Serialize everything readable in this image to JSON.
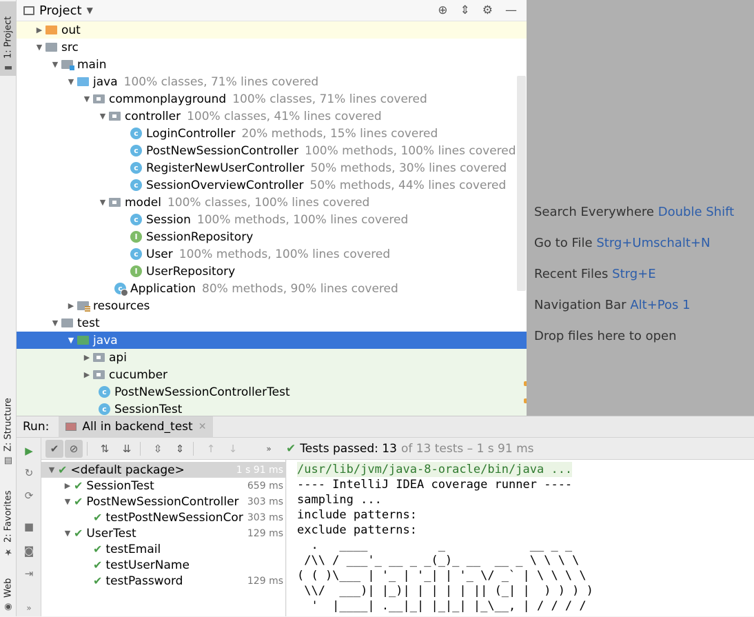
{
  "left_strip": {
    "tabs": [
      {
        "label": "1: Project",
        "icon": "folder-icon"
      },
      {
        "label": "Z: Structure",
        "icon": "structure-icon"
      },
      {
        "label": "2: Favorites",
        "icon": "star-icon"
      },
      {
        "label": "Web",
        "icon": "web-icon"
      }
    ]
  },
  "project": {
    "title": "Project",
    "tree": [
      {
        "label": "out",
        "cov": ""
      },
      {
        "label": "src",
        "cov": ""
      },
      {
        "label": "main",
        "cov": ""
      },
      {
        "label": "java",
        "cov": "100% classes, 71% lines covered"
      },
      {
        "label": "commonplayground",
        "cov": "100% classes, 71% lines covered"
      },
      {
        "label": "controller",
        "cov": "100% classes, 41% lines covered"
      },
      {
        "label": "LoginController",
        "cov": "20% methods, 15% lines covered"
      },
      {
        "label": "PostNewSessionController",
        "cov": "100% methods, 100% lines covered"
      },
      {
        "label": "RegisterNewUserController",
        "cov": "50% methods, 30% lines covered"
      },
      {
        "label": "SessionOverviewController",
        "cov": "50% methods, 44% lines covered"
      },
      {
        "label": "model",
        "cov": "100% classes, 100% lines covered"
      },
      {
        "label": "Session",
        "cov": "100% methods, 100% lines covered"
      },
      {
        "label": "SessionRepository",
        "cov": ""
      },
      {
        "label": "User",
        "cov": "100% methods, 100% lines covered"
      },
      {
        "label": "UserRepository",
        "cov": ""
      },
      {
        "label": "Application",
        "cov": "80% methods, 90% lines covered"
      },
      {
        "label": "resources",
        "cov": ""
      },
      {
        "label": "test",
        "cov": ""
      },
      {
        "label": "java",
        "cov": ""
      },
      {
        "label": "api",
        "cov": ""
      },
      {
        "label": "cucumber",
        "cov": ""
      },
      {
        "label": "PostNewSessionControllerTest",
        "cov": ""
      },
      {
        "label": "SessionTest",
        "cov": ""
      }
    ]
  },
  "hints": [
    {
      "text": "Search Everywhere",
      "key": "Double Shift"
    },
    {
      "text": "Go to File",
      "key": "Strg+Umschalt+N"
    },
    {
      "text": "Recent Files",
      "key": "Strg+E"
    },
    {
      "text": "Navigation Bar",
      "key": "Alt+Pos 1"
    },
    {
      "text": "Drop files here to open",
      "key": ""
    }
  ],
  "run": {
    "label": "Run:",
    "tab_label": "All in backend_test",
    "status_prefix": "Tests passed: 13",
    "status_suffix": "of 13 tests – 1 s 91 ms",
    "tests": [
      {
        "label": "<default package>",
        "time": "1 s 91 ms"
      },
      {
        "label": "SessionTest",
        "time": "659 ms"
      },
      {
        "label": "PostNewSessionController",
        "time": "303 ms"
      },
      {
        "label": "testPostNewSessionCor",
        "time": "303 ms"
      },
      {
        "label": "UserTest",
        "time": "129 ms"
      },
      {
        "label": "testEmail",
        "time": ""
      },
      {
        "label": "testUserName",
        "time": ""
      },
      {
        "label": "testPassword",
        "time": "129 ms"
      }
    ],
    "console": [
      "/usr/lib/jvm/java-8-oracle/bin/java ...",
      "---- IntelliJ IDEA coverage runner ----",
      "sampling ...",
      "include patterns:",
      "exclude patterns:",
      "  .   ____          _            __ _ _",
      " /\\\\ / ___'_ __ _ _(_)_ __  __ _ \\ \\ \\ \\",
      "( ( )\\___ | '_ | '_| | '_ \\/ _` | \\ \\ \\ \\",
      " \\\\/  ___)| |_)| | | | | || (_| |  ) ) ) )",
      "  '  |____| .__|_| |_|_| |_\\__, | / / / /"
    ]
  }
}
